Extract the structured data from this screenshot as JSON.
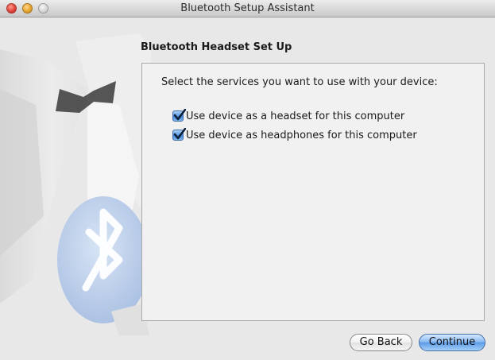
{
  "window": {
    "title": "Bluetooth Setup Assistant"
  },
  "content": {
    "step_title": "Bluetooth Headset Set Up",
    "prompt": "Select the services you want to use with your device:",
    "options": [
      {
        "label": "Use device as a headset for this computer",
        "checked": true
      },
      {
        "label": "Use device as headphones for this computer",
        "checked": true
      }
    ]
  },
  "buttons": {
    "back_label": "Go Back",
    "continue_label": "Continue"
  },
  "icons": {
    "background_art": "tuxedo-bluetooth-illustration",
    "close": "close-icon",
    "minimize": "minimize-icon",
    "zoom": "zoom-icon"
  },
  "colors": {
    "accent": "#5c9be6",
    "bluetooth_badge": "#bfd1ec"
  }
}
